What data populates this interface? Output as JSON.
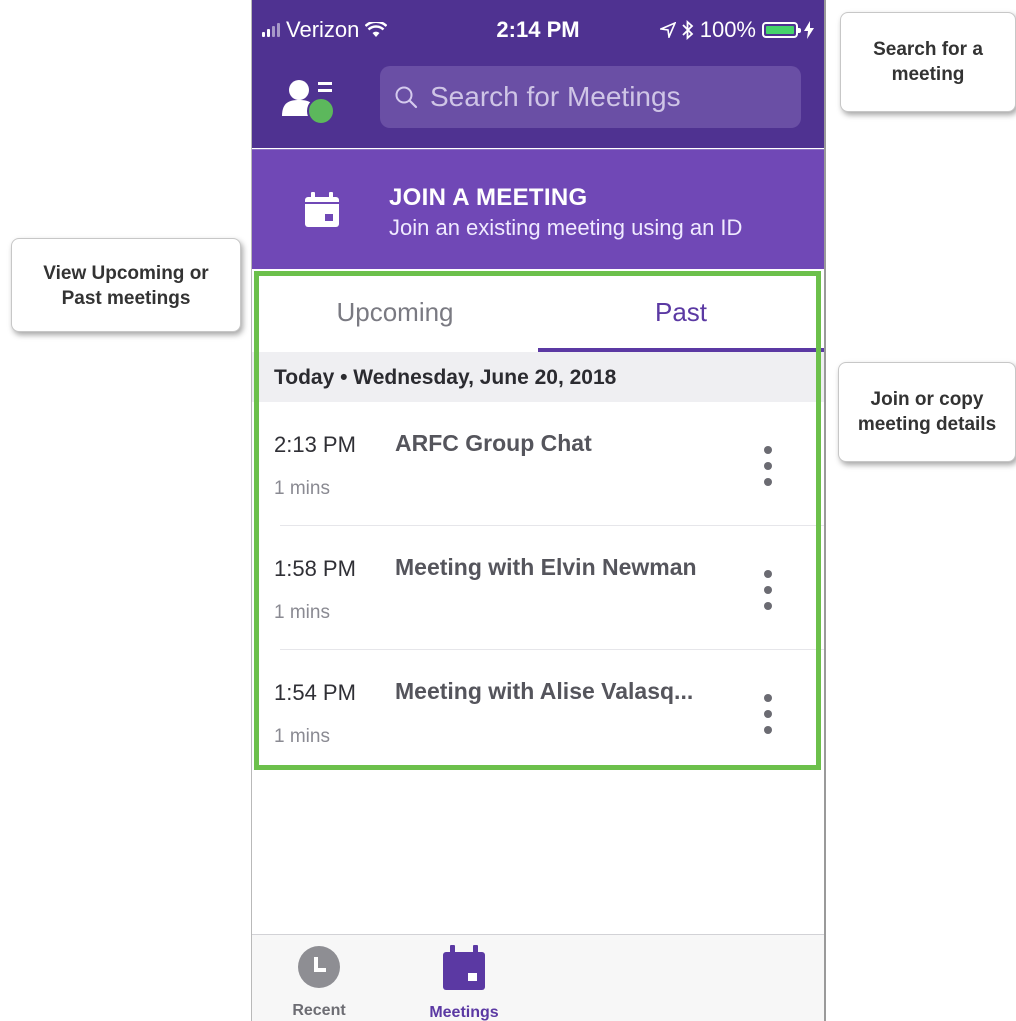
{
  "status_bar": {
    "carrier": "Verizon",
    "time": "2:14 PM",
    "battery": "100%"
  },
  "search": {
    "placeholder": "Search for Meetings"
  },
  "join_meeting": {
    "title": "JOIN A MEETING",
    "subtitle": "Join an existing meeting using an ID"
  },
  "tabs": {
    "upcoming": "Upcoming",
    "past": "Past",
    "active": "Past"
  },
  "section_header": "Today • Wednesday, June 20, 2018",
  "meetings": [
    {
      "time": "2:13 PM",
      "title": "ARFC Group Chat",
      "duration": "1 mins"
    },
    {
      "time": "1:58 PM",
      "title": "Meeting with Elvin Newman",
      "duration": "1 mins"
    },
    {
      "time": "1:54 PM",
      "title": "Meeting with Alise Valasq...",
      "duration": "1 mins"
    }
  ],
  "bottom_nav": {
    "recent": "Recent",
    "meetings": "Meetings",
    "active": "Meetings"
  },
  "callouts": {
    "search": "Search for a meeting",
    "tabs": "View Upcoming or Past meetings",
    "options": "Join or copy meeting details"
  },
  "colors": {
    "header_purple": "#4f3291",
    "join_purple": "#7048b6",
    "accent_purple": "#5b39a3",
    "highlight_green": "#6cc04b",
    "avatar_green": "#5cb85c",
    "battery_green": "#45d36b"
  }
}
